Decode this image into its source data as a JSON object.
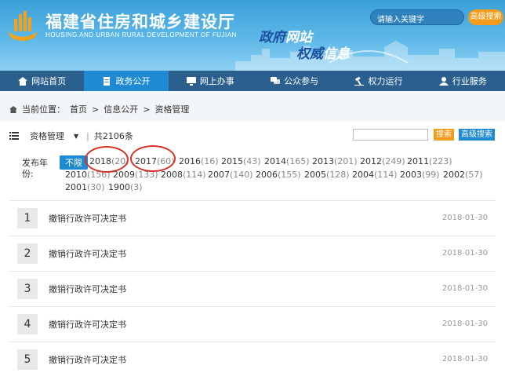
{
  "header": {
    "title": "福建省住房和城乡建设厅",
    "subtitle": "HOUSING AND URBAN RURAL DEVELOPMENT OF FUJIAN",
    "slogan1_a": "政府",
    "slogan1_b": "网站",
    "slogan2_a": "权威",
    "slogan2_b": "信息",
    "search_placeholder": "请输入关键字",
    "advanced_search": "高级搜索"
  },
  "nav": [
    {
      "label": "网站首页",
      "icon": "home-icon"
    },
    {
      "label": "政务公开",
      "icon": "document-icon",
      "active": true
    },
    {
      "label": "网上办事",
      "icon": "monitor-icon"
    },
    {
      "label": "公众参与",
      "icon": "chat-icon"
    },
    {
      "label": "权力运行",
      "icon": "gavel-icon"
    },
    {
      "label": "行业服务",
      "icon": "person-icon"
    }
  ],
  "breadcrumb": {
    "prefix": "当前位置：",
    "items": [
      "首页",
      "信息公开",
      "资格管理"
    ],
    "separator": ">"
  },
  "toolbar": {
    "category": "资格管理",
    "total": "共2106条",
    "search_btn": "搜索",
    "advanced_btn": "高级搜索"
  },
  "filter": {
    "label": "发布年份:",
    "years": [
      {
        "year": "不限",
        "count": "",
        "selected": true
      },
      {
        "year": "2018",
        "count": "(20)"
      },
      {
        "year": "2017",
        "count": "(60)"
      },
      {
        "year": "2016",
        "count": "(16)"
      },
      {
        "year": "2015",
        "count": "(43)"
      },
      {
        "year": "2014",
        "count": "(165)"
      },
      {
        "year": "2013",
        "count": "(201)"
      },
      {
        "year": "2012",
        "count": "(249)"
      },
      {
        "year": "2011",
        "count": "(223)"
      },
      {
        "year": "2010",
        "count": "(156)"
      },
      {
        "year": "2009",
        "count": "(133)"
      },
      {
        "year": "2008",
        "count": "(114)"
      },
      {
        "year": "2007",
        "count": "(140)"
      },
      {
        "year": "2006",
        "count": "(155)"
      },
      {
        "year": "2005",
        "count": "(128)"
      },
      {
        "year": "2004",
        "count": "(114)"
      },
      {
        "year": "2003",
        "count": "(99)"
      },
      {
        "year": "2002",
        "count": "(57)"
      },
      {
        "year": "2001",
        "count": "(30)"
      },
      {
        "year": "1900",
        "count": "(3)"
      }
    ]
  },
  "list": [
    {
      "num": "1",
      "title": "撤销行政许可决定书",
      "date": "2018-01-30"
    },
    {
      "num": "2",
      "title": "撤销行政许可决定书",
      "date": "2018-01-30"
    },
    {
      "num": "3",
      "title": "撤销行政许可决定书",
      "date": "2018-01-30"
    },
    {
      "num": "4",
      "title": "撤销行政许可决定书",
      "date": "2018-01-30"
    },
    {
      "num": "5",
      "title": "撤销行政许可决定书",
      "date": "2018-01-30"
    }
  ],
  "colors": {
    "nav_bg": "#2b5f8e",
    "nav_active": "#1f8ad1",
    "accent_orange": "#f39b1a",
    "annotation_red": "#d93025"
  }
}
